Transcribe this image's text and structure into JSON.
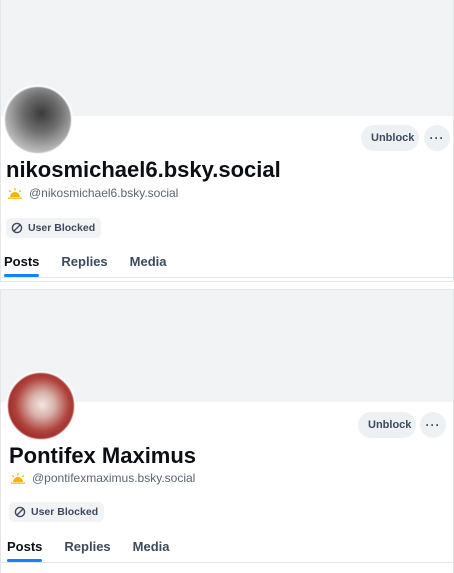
{
  "profiles": [
    {
      "display_name": "nikosmichael6.bsky.social",
      "handle": "@nikosmichael6.bsky.social",
      "unblock_label": "Unblock",
      "more_label": "···",
      "blocked_badge": "User Blocked",
      "tabs": [
        "Posts",
        "Replies",
        "Media"
      ],
      "active_tab": "Posts"
    },
    {
      "display_name": "Pontifex Maximus",
      "handle": "@pontifexmaximus.bsky.social",
      "unblock_label": "Unblock",
      "more_label": "···",
      "blocked_badge": "User Blocked",
      "tabs": [
        "Posts",
        "Replies",
        "Media"
      ],
      "active_tab": "Posts"
    }
  ],
  "colors": {
    "accent": "#1083fe",
    "banner": "#f1f3f5",
    "sun_icon": "#f5b400"
  },
  "icons": {
    "sun": "sun-icon",
    "block": "block-icon"
  }
}
